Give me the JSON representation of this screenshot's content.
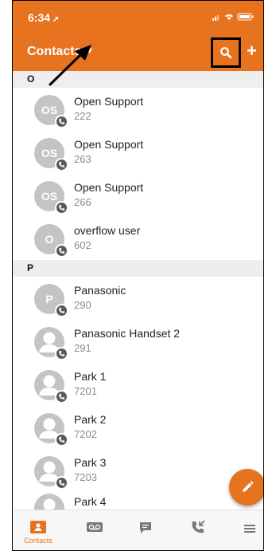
{
  "status_bar": {
    "time": "6:34"
  },
  "app_bar": {
    "title": "Contacts",
    "add_label": "+"
  },
  "sections": [
    {
      "letter": "O",
      "contacts": [
        {
          "initials": "OS",
          "name": "Open Support",
          "ext": "222"
        },
        {
          "initials": "OS",
          "name": "Open Support",
          "ext": "263"
        },
        {
          "initials": "OS",
          "name": "Open Support",
          "ext": "266"
        },
        {
          "initials": "O",
          "name": "overflow user",
          "ext": "602"
        }
      ]
    },
    {
      "letter": "P",
      "contacts": [
        {
          "initials": "P",
          "name": "Panasonic",
          "ext": "290"
        },
        {
          "initials": "",
          "name": "Panasonic Handset 2",
          "ext": "291"
        },
        {
          "initials": "",
          "name": "Park 1",
          "ext": "7201"
        },
        {
          "initials": "",
          "name": "Park 2",
          "ext": "7202"
        },
        {
          "initials": "",
          "name": "Park 3",
          "ext": "7203"
        },
        {
          "initials": "",
          "name": "Park 4",
          "ext": ""
        }
      ]
    }
  ],
  "tab_bar": {
    "contacts_label": "Contacts"
  },
  "colors": {
    "accent": "#e8731f",
    "avatar": "#c4c4c4",
    "badge": "#5a5a5a"
  },
  "icons": [
    "search-icon",
    "add-icon",
    "dropdown-caret-icon",
    "phone-badge-icon",
    "edit-icon",
    "contacts-tab-icon",
    "voicemail-tab-icon",
    "messages-tab-icon",
    "calls-tab-icon",
    "menu-tab-icon"
  ]
}
